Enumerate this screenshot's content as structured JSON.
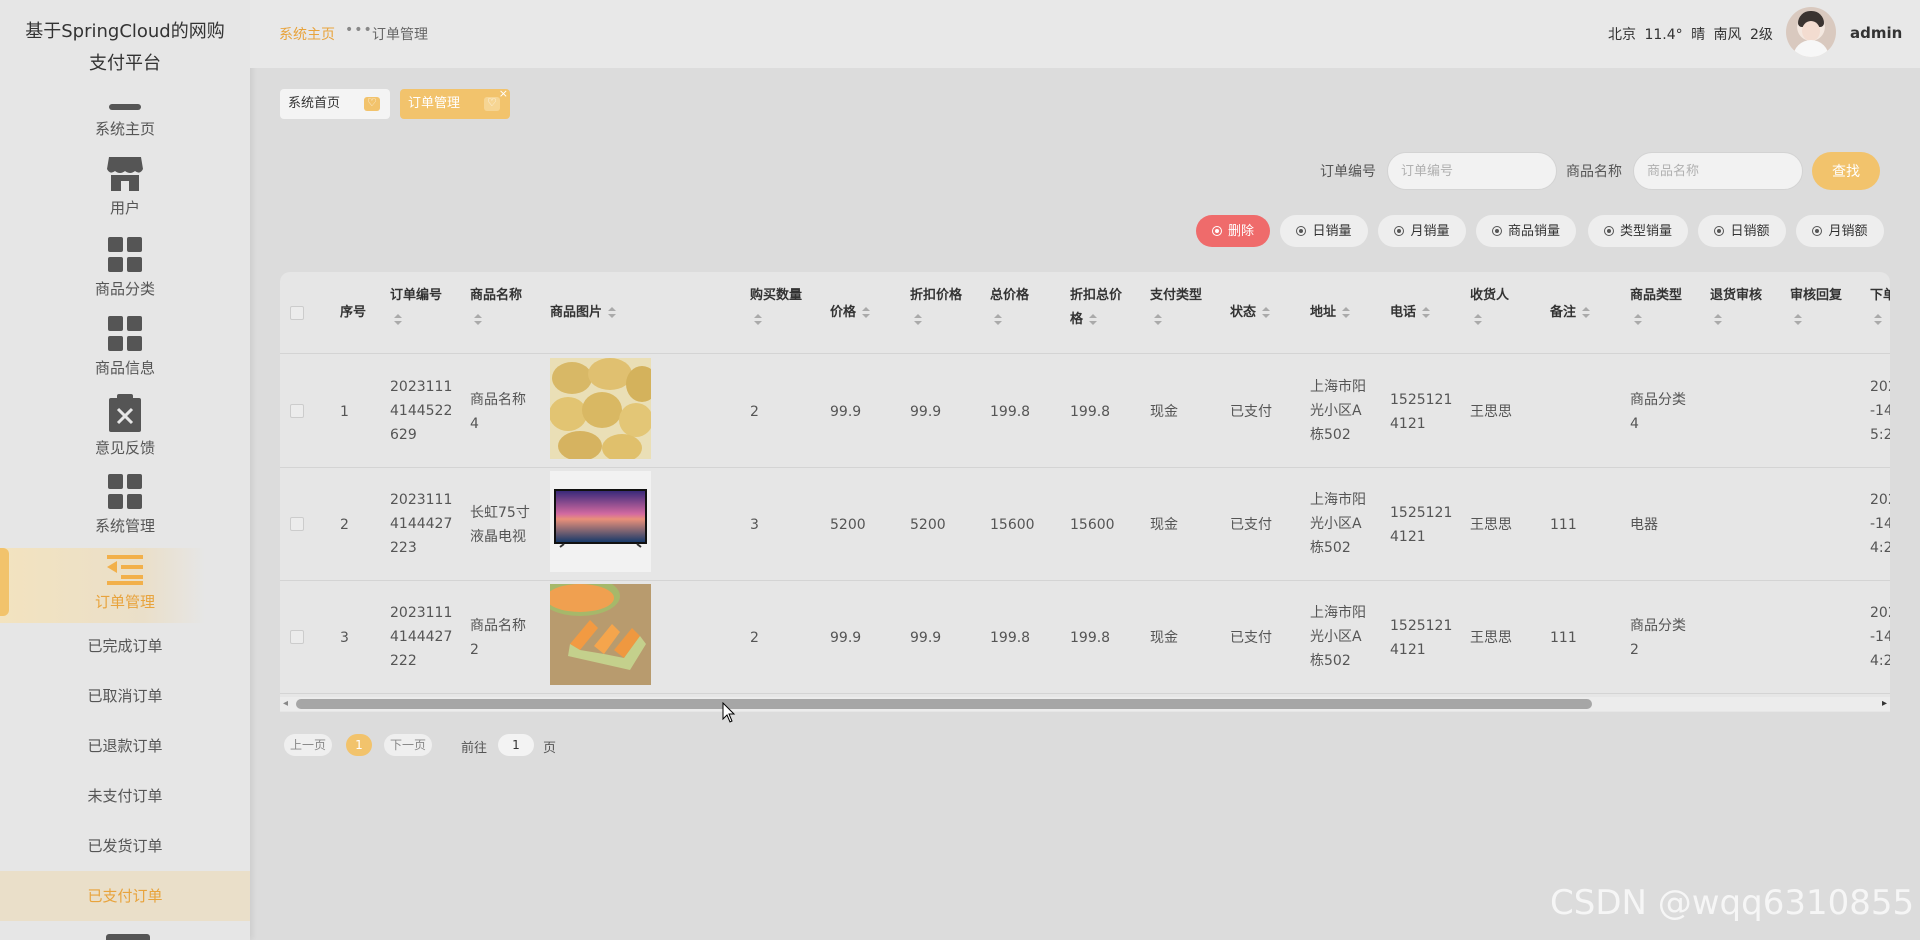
{
  "sidebar": {
    "brand_line1": "基于SpringCloud的网购",
    "brand_line2": "支付平台",
    "items": [
      {
        "label": "系统主页",
        "icon": "home-icon"
      },
      {
        "label": "用户",
        "icon": "store-icon"
      },
      {
        "label": "商品分类",
        "icon": "grid-icon"
      },
      {
        "label": "商品信息",
        "icon": "grid-icon"
      },
      {
        "label": "意见反馈",
        "icon": "clipboard-x-icon"
      },
      {
        "label": "系统管理",
        "icon": "grid-icon"
      },
      {
        "label": "订单管理",
        "icon": "menu-list-icon"
      }
    ],
    "sub_items": [
      "已完成订单",
      "已取消订单",
      "已退款订单",
      "未支付订单",
      "已发货订单",
      "已支付订单"
    ],
    "active_item": "订单管理",
    "active_sub_item": "已支付订单"
  },
  "topbar": {
    "breadcrumb_home": "系统主页",
    "breadcrumb_sep": "•••",
    "breadcrumb_current": "订单管理",
    "weather": "北京  11.4°  晴  南风  2级",
    "username": "admin"
  },
  "tabs": [
    {
      "label": "系统首页",
      "active": false
    },
    {
      "label": "订单管理",
      "active": true,
      "close": "×"
    }
  ],
  "search": {
    "order_no_label": "订单编号",
    "order_no_placeholder": "订单编号",
    "product_name_label": "商品名称",
    "product_name_placeholder": "商品名称",
    "search_button": "查找"
  },
  "actions": [
    "删除",
    "日销量",
    "月销量",
    "商品销量",
    "类型销量",
    "日销额",
    "月销额"
  ],
  "table": {
    "headers": [
      "序号",
      "订单编号",
      "商品名称",
      "商品图片",
      "购买数量",
      "价格",
      "折扣价格",
      "总价格",
      "折扣总价格",
      "支付类型",
      "状态",
      "地址",
      "电话",
      "收货人",
      "备注",
      "商品类型",
      "退货审核",
      "审核回复",
      "下单"
    ],
    "rows": [
      {
        "idx": "1",
        "order_no": [
          "2023111",
          "4144522",
          "629"
        ],
        "name": [
          "商品名称",
          "4"
        ],
        "image": "potatoes",
        "qty": "2",
        "price": "99.9",
        "discount_price": "99.9",
        "total": "199.8",
        "discount_total": "199.8",
        "pay_type": "现金",
        "status": "已支付",
        "address": [
          "上海市阳",
          "光小区A",
          "栋502"
        ],
        "phone": [
          "1525121",
          "4121"
        ],
        "receiver": "王思思",
        "remark": "",
        "category": [
          "商品分类",
          "4"
        ],
        "time": [
          "202",
          "-14",
          "5:2"
        ]
      },
      {
        "idx": "2",
        "order_no": [
          "2023111",
          "4144427",
          "223"
        ],
        "name": [
          "长虹75寸",
          "液晶电视"
        ],
        "image": "tv",
        "qty": "3",
        "price": "5200",
        "discount_price": "5200",
        "total": "15600",
        "discount_total": "15600",
        "pay_type": "现金",
        "status": "已支付",
        "address": [
          "上海市阳",
          "光小区A",
          "栋502"
        ],
        "phone": [
          "1525121",
          "4121"
        ],
        "receiver": "王思思",
        "remark": "111",
        "category": [
          "电器"
        ],
        "time": [
          "202",
          "-14",
          "4:2"
        ]
      },
      {
        "idx": "3",
        "order_no": [
          "2023111",
          "4144427",
          "222"
        ],
        "name": [
          "商品名称",
          "2"
        ],
        "image": "melon",
        "qty": "2",
        "price": "99.9",
        "discount_price": "99.9",
        "total": "199.8",
        "discount_total": "199.8",
        "pay_type": "现金",
        "status": "已支付",
        "address": [
          "上海市阳",
          "光小区A",
          "栋502"
        ],
        "phone": [
          "1525121",
          "4121"
        ],
        "receiver": "王思思",
        "remark": "111",
        "category": [
          "商品分类",
          "2"
        ],
        "time": [
          "202",
          "-14",
          "4:2"
        ]
      }
    ]
  },
  "pagination": {
    "prev": "上一页",
    "current": "1",
    "next": "下一页",
    "goto_prefix": "前往",
    "goto_value": "1",
    "goto_suffix": "页"
  },
  "watermark": "CSDN @wqq6310855",
  "colors": {
    "accent": "#f2c36c",
    "accent_text": "#e8a33c",
    "danger": "#ef6b6b"
  }
}
